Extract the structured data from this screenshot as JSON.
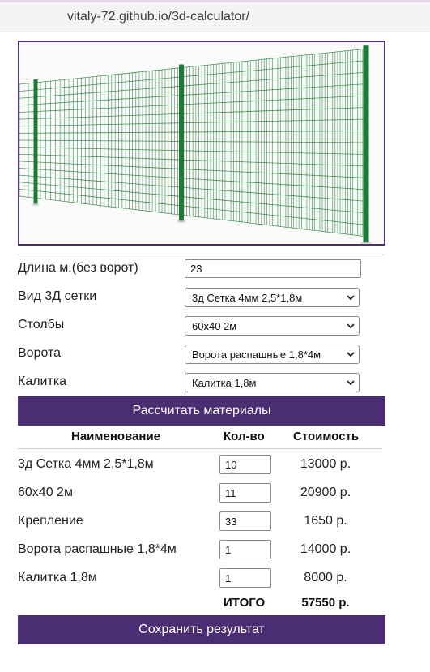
{
  "browser": {
    "url": "vitaly-72.github.io/3d-calculator/"
  },
  "hero": {
    "image": "3d-fence-panel-image"
  },
  "form": {
    "length_label": "Длина м.(без ворот)",
    "length_value": "23",
    "mesh_label": "Вид 3Д сетки",
    "mesh_value": "3д Сетка 4мм 2,5*1,8м",
    "posts_label": "Столбы",
    "posts_value": "60х40 2м",
    "gates_label": "Ворота",
    "gates_value": "Ворота распашные 1,8*4м",
    "wicket_label": "Калитка",
    "wicket_value": "Калитка 1,8м"
  },
  "calc_button": "Рассчитать материалы",
  "table": {
    "headers": [
      "Наименование",
      "Кол-во",
      "Стоимость"
    ],
    "rows": [
      {
        "name": "3д Сетка 4мм 2,5*1,8м",
        "qty": "10",
        "cost": "13000 р."
      },
      {
        "name": "60х40 2м",
        "qty": "11",
        "cost": "20900 р."
      },
      {
        "name": "Крепление",
        "qty": "33",
        "cost": "1650 р."
      },
      {
        "name": "Ворота распашные 1,8*4м",
        "qty": "1",
        "cost": "14000 р."
      },
      {
        "name": "Калитка 1,8м",
        "qty": "1",
        "cost": "8000 р."
      }
    ],
    "total_label": "ИТОГО",
    "total_value": "57550 р."
  },
  "save_button": "Сохранить результат",
  "colors": {
    "accent": "#4b2d73",
    "fence": "#1f7a35"
  }
}
